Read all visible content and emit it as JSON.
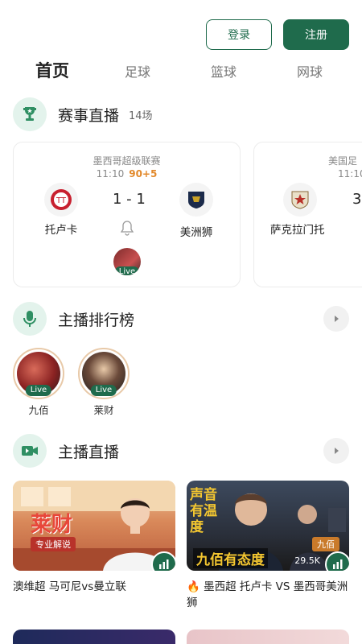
{
  "auth": {
    "login_label": "登录",
    "register_label": "注册"
  },
  "tabs": [
    {
      "label": "首页",
      "active": true
    },
    {
      "label": "足球",
      "active": false
    },
    {
      "label": "篮球",
      "active": false
    },
    {
      "label": "网球",
      "active": false
    }
  ],
  "live_events": {
    "title": "赛事直播",
    "count": "14场",
    "icon": "trophy-icon",
    "matches": [
      {
        "league": "墨西哥超级联赛",
        "time": "11:10",
        "extra_time": "90+5",
        "home": "托卢卡",
        "away": "美洲狮",
        "score": "1 - 1",
        "live_label": "Live"
      },
      {
        "league": "美国足",
        "time": "11:10",
        "home": "萨克拉门托",
        "score": "3"
      }
    ]
  },
  "anchor_ranking": {
    "title": "主播排行榜",
    "icon": "microphone-icon",
    "anchors": [
      {
        "name": "九佰",
        "live_label": "Live"
      },
      {
        "name": "莱财",
        "live_label": "Live"
      }
    ]
  },
  "anchor_live": {
    "title": "主播直播",
    "icon": "video-camera-icon",
    "streams": [
      {
        "title": "澳维超 马可尼vs曼立联",
        "tag": "专业解说",
        "banner": "莱财"
      },
      {
        "title": "🔥 墨西超 托卢卡 VS 墨西哥美洲狮",
        "viewers": "29.5K",
        "banner_top": "声音有温度",
        "banner_bottom": "九佰有态度",
        "badge": "九佰"
      }
    ]
  },
  "colors": {
    "accent": "#1f6b4c",
    "extra_time": "#e2892b",
    "icon_bg": "#e3f3ec"
  }
}
